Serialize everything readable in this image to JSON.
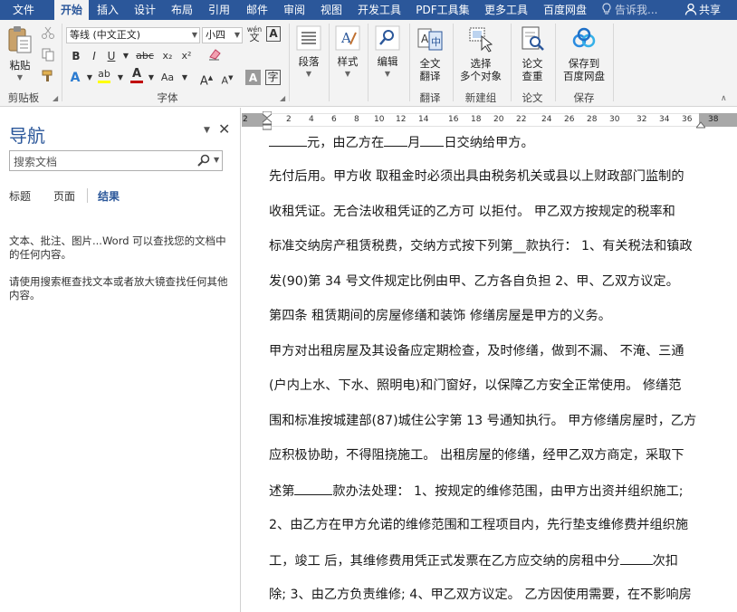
{
  "menu": {
    "file": "文件",
    "tabs": [
      "开始",
      "插入",
      "设计",
      "布局",
      "引用",
      "邮件",
      "审阅",
      "视图",
      "开发工具",
      "PDF工具集",
      "更多工具",
      "百度网盘"
    ],
    "active_tab": "开始",
    "tell_me": "告诉我...",
    "share": "共享"
  },
  "ribbon": {
    "clipboard": {
      "paste": "粘贴",
      "label": "剪贴板"
    },
    "font": {
      "font_name": "等线 (中文正文)",
      "font_size": "小四",
      "wen": "wén",
      "wen_char": "文",
      "A_box": "A",
      "bold": "B",
      "italic": "I",
      "underline": "U",
      "strike": "abc",
      "subscript": "x₂",
      "superscript": "x²",
      "text_effects": "A",
      "highlight": "ab",
      "font_color": "A",
      "change_case": "Aa",
      "grow": "A",
      "shrink": "A",
      "char_shading": "A",
      "char_border": "字",
      "label": "字体"
    },
    "paragraph": {
      "label": "段落"
    },
    "styles": {
      "label": "样式"
    },
    "editing": {
      "label": "编辑"
    },
    "translate": {
      "button": "全文\n翻译",
      "line1": "全文",
      "line2": "翻译",
      "label": "翻译"
    },
    "new_group": {
      "line1": "选择",
      "line2": "多个对象",
      "label": "新建组"
    },
    "paper": {
      "line1": "论文",
      "line2": "查重",
      "label": "论文"
    },
    "save": {
      "line1": "保存到",
      "line2": "百度网盘",
      "label": "保存"
    },
    "colors": {
      "brand": "#2b579a",
      "font_color_bar": "#c00000",
      "highlight_bar": "#ffff00"
    }
  },
  "nav": {
    "title": "导航",
    "search_placeholder": "搜索文档",
    "tabs": [
      "标题",
      "页面",
      "结果"
    ],
    "active_tab": "结果",
    "message1": "文本、批注、图片...Word 可以查找您的文档中的任何内容。",
    "message2": "请使用搜索框查找文本或者放大镜查找任何其他内容。"
  },
  "ruler": {
    "ticks": [
      "2",
      "2",
      "4",
      "6",
      "8",
      "10",
      "12",
      "14",
      "16",
      "18",
      "20",
      "22",
      "24",
      "26",
      "28",
      "30",
      "32",
      "34",
      "36",
      "38"
    ]
  },
  "document": {
    "lines": [
      {
        "pre": "",
        "blank1": "______",
        "mid": "元，由乙方在",
        "blank2": "___",
        "mid2": "月",
        "blank3": "___",
        "post": "日交纳给甲方。"
      },
      {
        "text": "先付后用。甲方收  取租金时必须出具由税务机关或县以上财政部门监制的"
      },
      {
        "text": "收租凭证。无合法收租凭证的乙方可  以拒付。  甲乙双方按规定的税率和"
      },
      {
        "text": "标准交纳房产租赁税费，交纳方式按下列第__款执行：  1、有关税法和镇政"
      },
      {
        "text": "发(90)第 34 号文件规定比例由甲、乙方各自负担 2、甲、乙双方议定。"
      },
      {
        "text": "第四条  租赁期间的房屋修缮和装饰  修缮房屋是甲方的义务。"
      },
      {
        "text": "甲方对出租房屋及其设备应定期检查，及时修缮，做到不漏、  不淹、三通"
      },
      {
        "text": "(户内上水、下水、照明电)和门窗好，以保障乙方安全正常使用。  修缮范"
      },
      {
        "text": "围和标准按城建部(87)城住公字第 13 号通知执行。  甲方修缮房屋时，乙方"
      },
      {
        "text": "应积极协助，不得阻挠施工。  出租房屋的修缮，经甲乙双方商定，采取下"
      },
      {
        "pre": "述第",
        "blank1": "______",
        "post": "款办法处理：   1、按规定的维修范围，由甲方出资并组织施工;"
      },
      {
        "text": "2、由乙方在甲方允诺的维修范围和工程项目内，先行垫支维修费并组织施"
      },
      {
        "pre": "工，竣工  后，其维修费用凭正式发票在乙方应交纳的房租中分",
        "blank1": "______",
        "post": "次扣"
      },
      {
        "text": "除; 3、由乙方负责维修; 4、甲乙双方议定。  乙方因使用需要，在不影响房"
      }
    ]
  }
}
